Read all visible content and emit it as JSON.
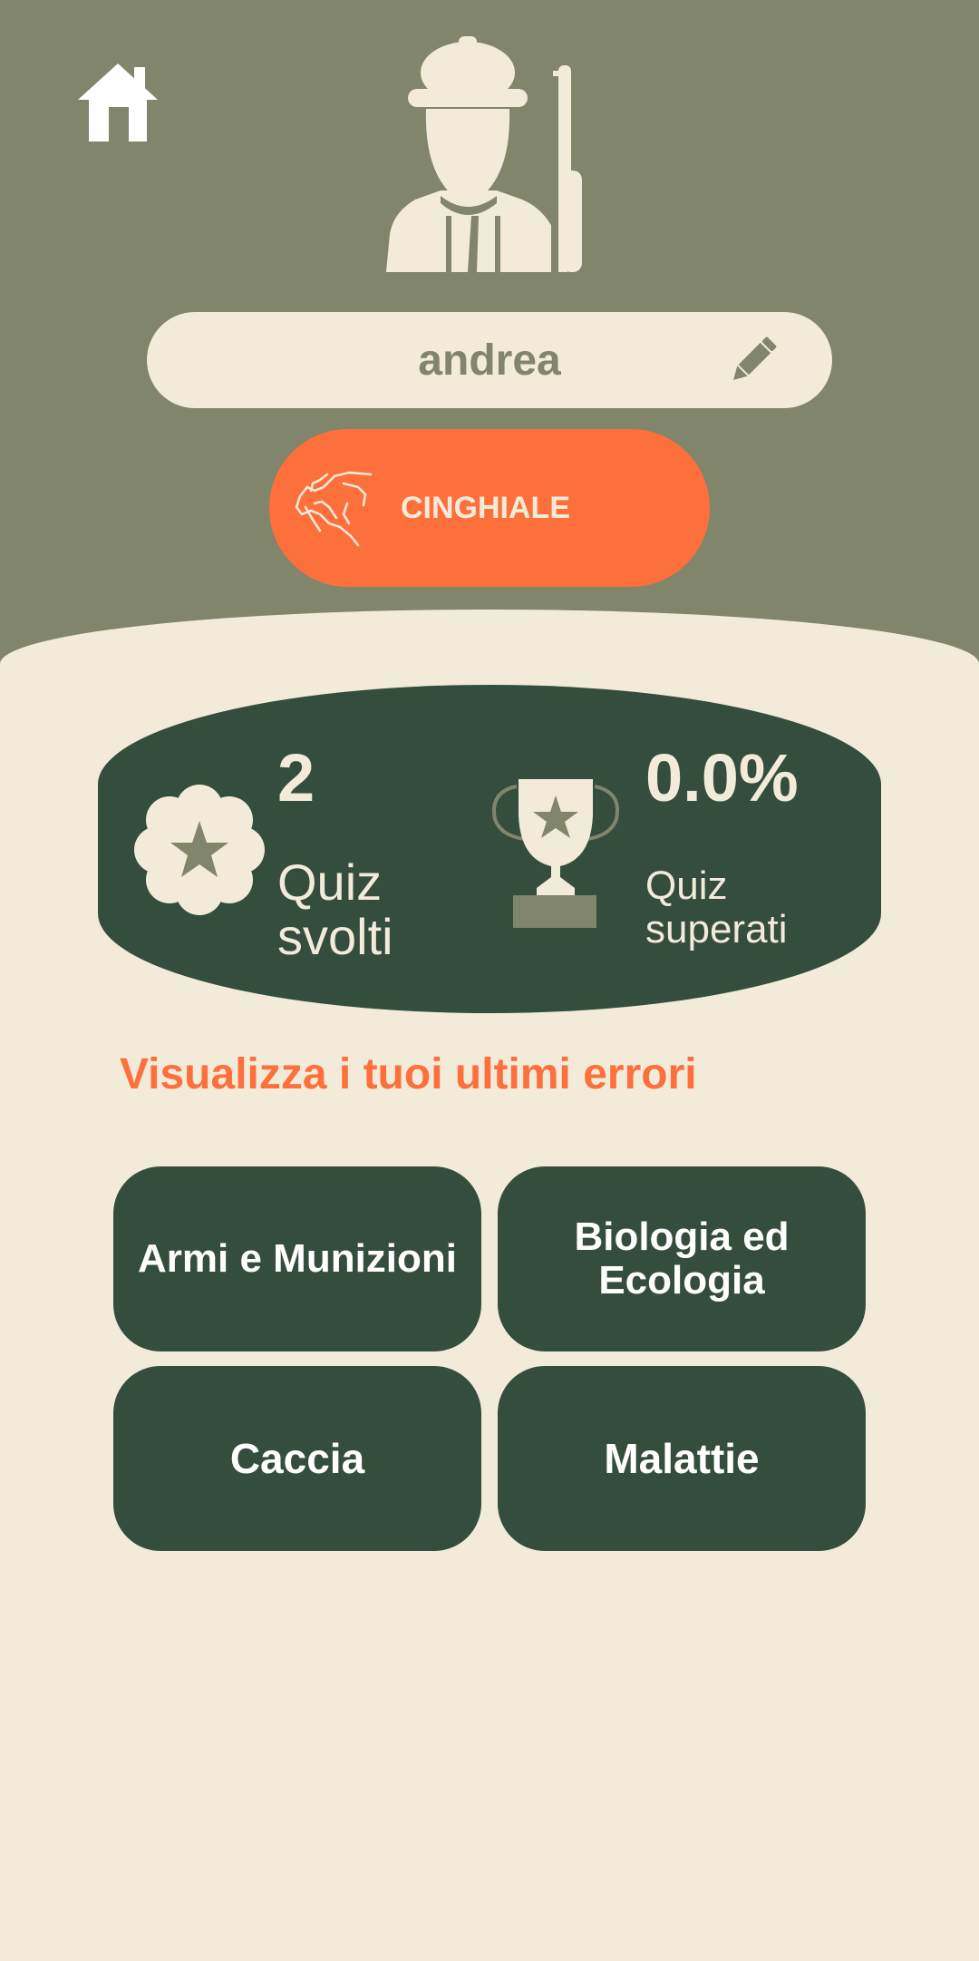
{
  "colors": {
    "olive": "#80856c",
    "cream": "#f2ebda",
    "orange": "#fe703b",
    "dark_green": "#354d3c"
  },
  "header": {
    "home_icon": "home-icon",
    "avatar_icon": "hunter-avatar-icon",
    "username": "andrea",
    "edit_icon": "pencil-icon",
    "species": {
      "label": "CINGHIALE",
      "icon": "boar-icon"
    }
  },
  "stats": {
    "quiz_done": {
      "value": "2",
      "label_line1": "Quiz",
      "label_line2": "svolti",
      "icon": "flower-star-icon"
    },
    "quiz_passed": {
      "value": "0.0%",
      "label_line1": "Quiz",
      "label_line2": "superati",
      "icon": "trophy-icon"
    }
  },
  "errors_link": "Visualizza i tuoi ultimi errori",
  "categories": [
    {
      "line1": "Armi e Munizioni",
      "line2": ""
    },
    {
      "line1": "Biologia ed",
      "line2": "Ecologia"
    },
    {
      "line1": "Caccia",
      "line2": ""
    },
    {
      "line1": "Malattie",
      "line2": ""
    }
  ]
}
